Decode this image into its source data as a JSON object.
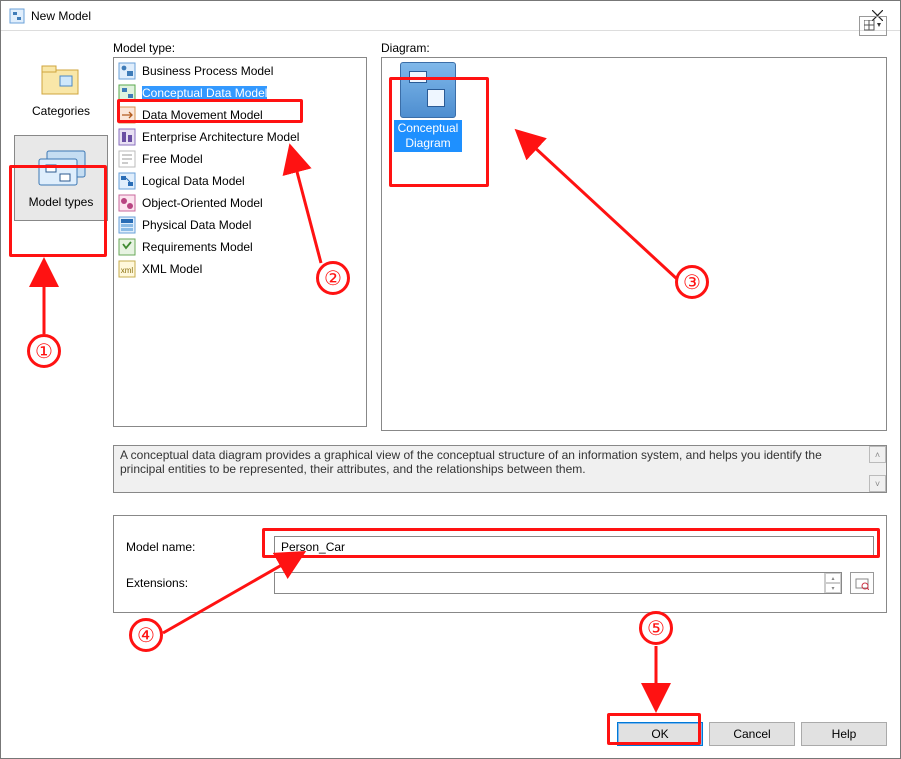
{
  "window": {
    "title": "New Model"
  },
  "sidebar": {
    "items": [
      {
        "label": "Categories",
        "selected": false
      },
      {
        "label": "Model types",
        "selected": true
      }
    ]
  },
  "columns": {
    "model_type_label": "Model type:",
    "diagram_label": "Diagram:"
  },
  "model_types": [
    {
      "label": "Business Process Model"
    },
    {
      "label": "Conceptual Data Model",
      "selected": true
    },
    {
      "label": "Data Movement Model"
    },
    {
      "label": "Enterprise Architecture Model"
    },
    {
      "label": "Free Model"
    },
    {
      "label": "Logical Data Model"
    },
    {
      "label": "Object-Oriented Model"
    },
    {
      "label": "Physical Data Model"
    },
    {
      "label": "Requirements Model"
    },
    {
      "label": "XML Model"
    }
  ],
  "diagrams": [
    {
      "line1": "Conceptual",
      "line2": "Diagram",
      "selected": true
    }
  ],
  "description": "A conceptual data diagram provides a graphical view of the conceptual structure of an information system, and helps you identify the principal entities to be represented, their attributes, and the relationships between them.",
  "form": {
    "model_name_label": "Model name:",
    "model_name_value": "Person_Car",
    "extensions_label": "Extensions:",
    "extensions_value": ""
  },
  "buttons": {
    "ok": "OK",
    "cancel": "Cancel",
    "help": "Help"
  },
  "callouts": {
    "c1": "①",
    "c2": "②",
    "c3": "③",
    "c4": "④",
    "c5": "⑤"
  }
}
